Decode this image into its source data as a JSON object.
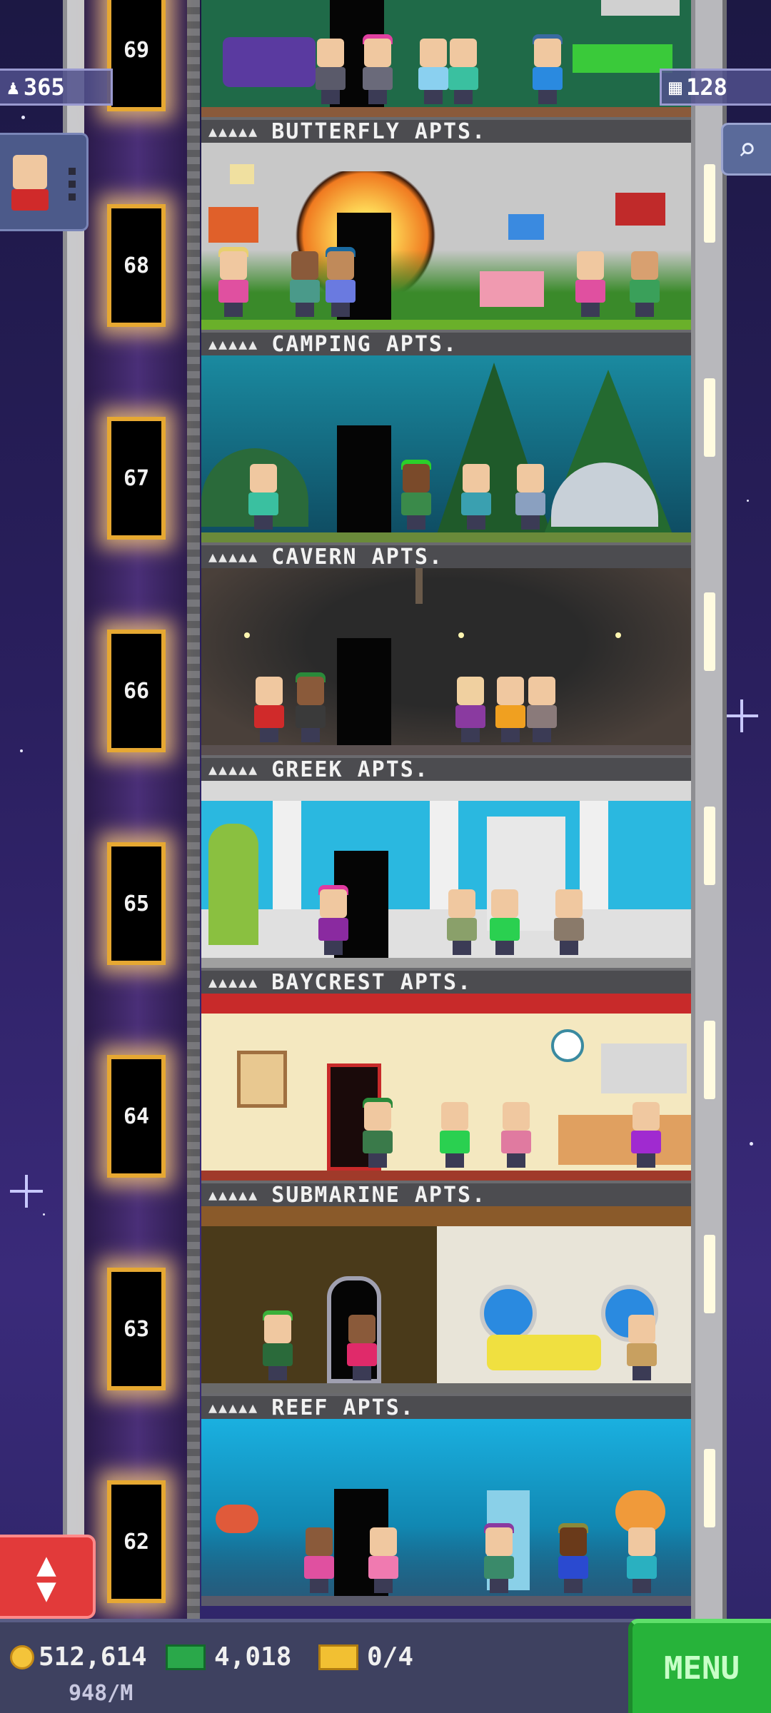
{
  "hud": {
    "population": "365",
    "floors_count": "128"
  },
  "floors": [
    {
      "number": "69",
      "name": ""
    },
    {
      "number": "68",
      "name": "BUTTERFLY APTS."
    },
    {
      "number": "67",
      "name": "CAMPING APTS."
    },
    {
      "number": "66",
      "name": "CAVERN APTS."
    },
    {
      "number": "65",
      "name": "GREEK APTS."
    },
    {
      "number": "64",
      "name": "BAYCREST APTS."
    },
    {
      "number": "63",
      "name": "SUBMARINE APTS."
    },
    {
      "number": "62",
      "name": "REEF APTS."
    }
  ],
  "stars_label": "▲▲▲▲▲",
  "bottom_bar": {
    "coins": "512,614",
    "coin_rate": "948/M",
    "bux": "4,018",
    "tickets": "0/4",
    "menu_label": "MENU"
  },
  "icons": {
    "population": "person-icon",
    "floors": "building-icon",
    "search": "magnifier-icon",
    "elevator": "up-down-arrows-icon",
    "coin": "coin-icon",
    "bux": "bux-icon",
    "ticket": "ticket-icon"
  },
  "colors": {
    "menu": "#27b33a",
    "elevator_button": "#e23a3a",
    "door_glow": "#ffcd78"
  }
}
